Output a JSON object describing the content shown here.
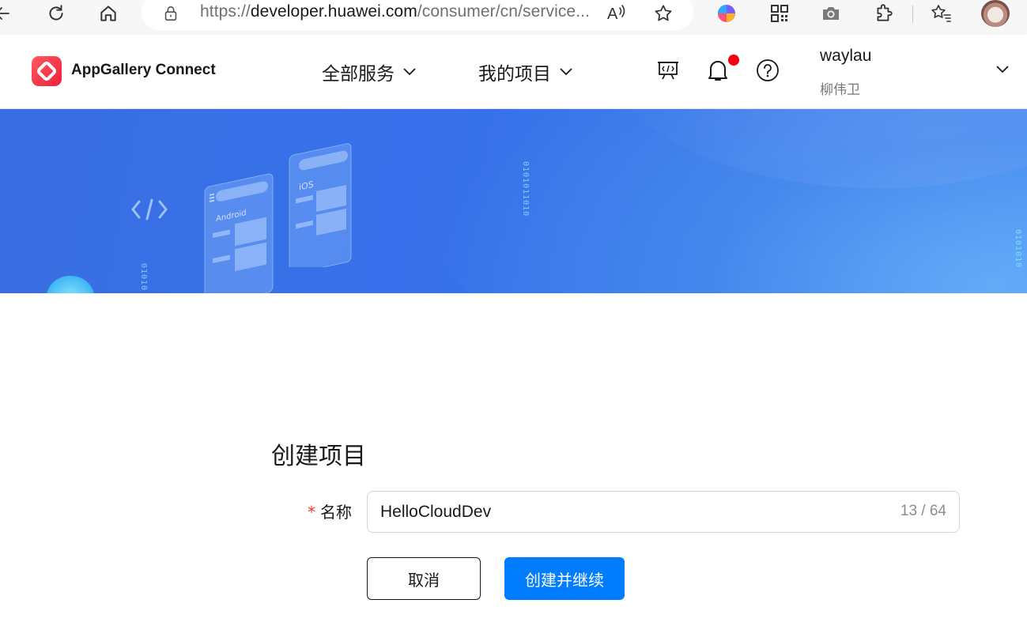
{
  "browser": {
    "url_prefix": "https://",
    "url_host": "developer.huawei.com",
    "url_path": "/consumer/cn/service...",
    "icons": [
      "back-icon",
      "refresh-icon",
      "home-icon",
      "lock-icon",
      "read-aloud-icon",
      "favorite-star-icon",
      "copilot-icon",
      "qr-code-icon",
      "camera-icon",
      "extensions-icon",
      "favorites-icon",
      "profile-avatar"
    ]
  },
  "header": {
    "brand": "AppGallery Connect",
    "nav": [
      {
        "label": "全部服务"
      },
      {
        "label": "我的项目"
      }
    ],
    "user": {
      "name": "waylau",
      "display_name": "柳伟卫"
    },
    "notification_dot_color": "#f5000f"
  },
  "banner": {
    "bits_a": "0101011010",
    "bits_b": "01010",
    "bits_c": "0101010"
  },
  "form": {
    "title": "创建项目",
    "required_mark": "*",
    "name_label": "名称",
    "name_value": "HelloCloudDev",
    "counter": "13 / 64",
    "cancel_label": "取消",
    "submit_label": "创建并继续"
  },
  "colors": {
    "primary": "#007dff",
    "brand_red": "#f0203b",
    "required": "#e84026"
  }
}
